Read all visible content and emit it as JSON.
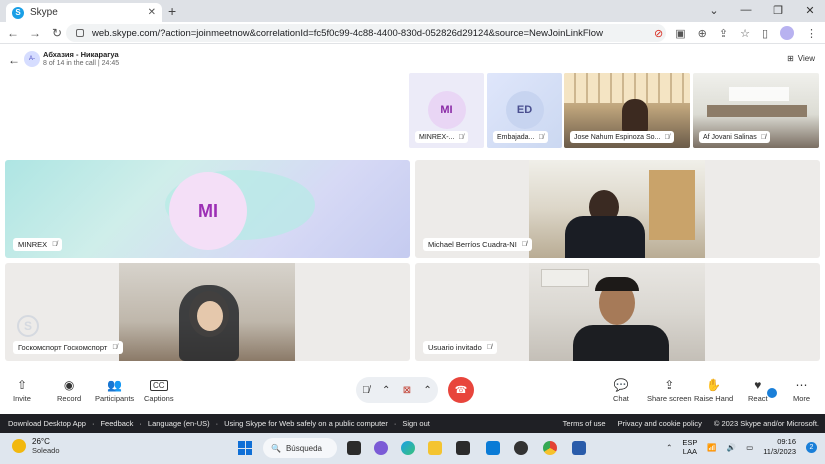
{
  "browser": {
    "tab_title": "Skype",
    "tab_logo": "S",
    "url": "web.skype.com/?action=joinmeetnow&correlationId=fc5f0c99-4c88-4400-830d-052826d29124&source=NewJoinLinkFlow"
  },
  "call": {
    "avatar_initials": "A-",
    "title": "Абхазия - Никарагуа",
    "subtitle": "8 of 14 in the call | 24:45",
    "view_label": "View"
  },
  "thumbnails": [
    {
      "initials": "MI",
      "label": "MINREX-...",
      "bg": "#ecebf8",
      "circle": "#e9d6f5",
      "text_color": "#8a2aa6"
    },
    {
      "initials": "ED",
      "label": "Embajada...",
      "bg": "#d6e0f3",
      "circle": "#c7d4f0",
      "text_color": "#4a4f8f"
    },
    {
      "label": "Jose Nahum Espinoza So..."
    },
    {
      "label": "Af Jovani Salinas"
    }
  ],
  "tiles": {
    "minrex": {
      "initials": "MI",
      "label": "MINREX"
    },
    "michael": {
      "label": "Michael Berríos Cuadra-NI"
    },
    "goskom": {
      "label": "Госкомспорт Госкомспорт"
    },
    "invitado": {
      "label": "Usuario invitado"
    }
  },
  "controls": {
    "invite": "Invite",
    "record": "Record",
    "participants": "Participants",
    "captions": "Captions",
    "chat": "Chat",
    "share_screen": "Share screen",
    "raise_hand": "Raise Hand",
    "react": "React",
    "more": "More"
  },
  "footer": {
    "links_left": [
      "Download Desktop App",
      "·",
      "Feedback",
      "·",
      "Language (en-US)",
      "·",
      "Using Skype for Web safely on a public computer",
      "·",
      "Sign out"
    ],
    "links_right": [
      "Terms of use",
      "Privacy and cookie policy",
      "© 2023 Skype and/or Microsoft."
    ]
  },
  "taskbar": {
    "temperature": "26°C",
    "condition": "Soleado",
    "search": "Búsqueda",
    "lang_top": "ESP",
    "lang_bottom": "LAA",
    "time": "09:16",
    "date": "11/3/2023",
    "notifications": "2"
  }
}
